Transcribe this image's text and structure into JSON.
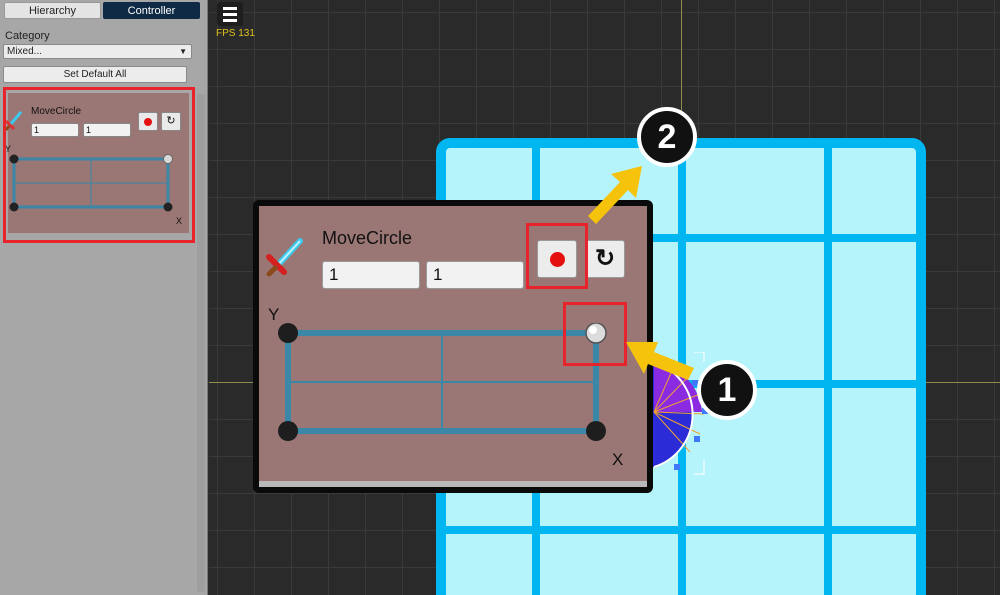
{
  "tabs": [
    {
      "label": "Hierarchy",
      "active": false
    },
    {
      "label": "Controller",
      "active": true
    }
  ],
  "category": {
    "label": "Category",
    "selected": "Mixed..."
  },
  "set_default_label": "Set Default All",
  "controller": {
    "name": "MoveCircle",
    "x_value": "1",
    "y_value": "1",
    "axis_x": "X",
    "axis_y": "Y"
  },
  "scene": {
    "fps_text": "FPS 131"
  },
  "badges": {
    "one": "1",
    "two": "2"
  },
  "colors": {
    "accent_tab": "#0f2a44",
    "card_bg": "#9a7775",
    "highlight": "#e8232c",
    "arrow": "#f5c30c",
    "grid_line": "#00b6f0",
    "grid_fill": "#b6f4fc",
    "fps": "#e2c21c"
  },
  "icons": [
    "menu-icon",
    "sword-icon",
    "record-icon",
    "reset-icon"
  ]
}
